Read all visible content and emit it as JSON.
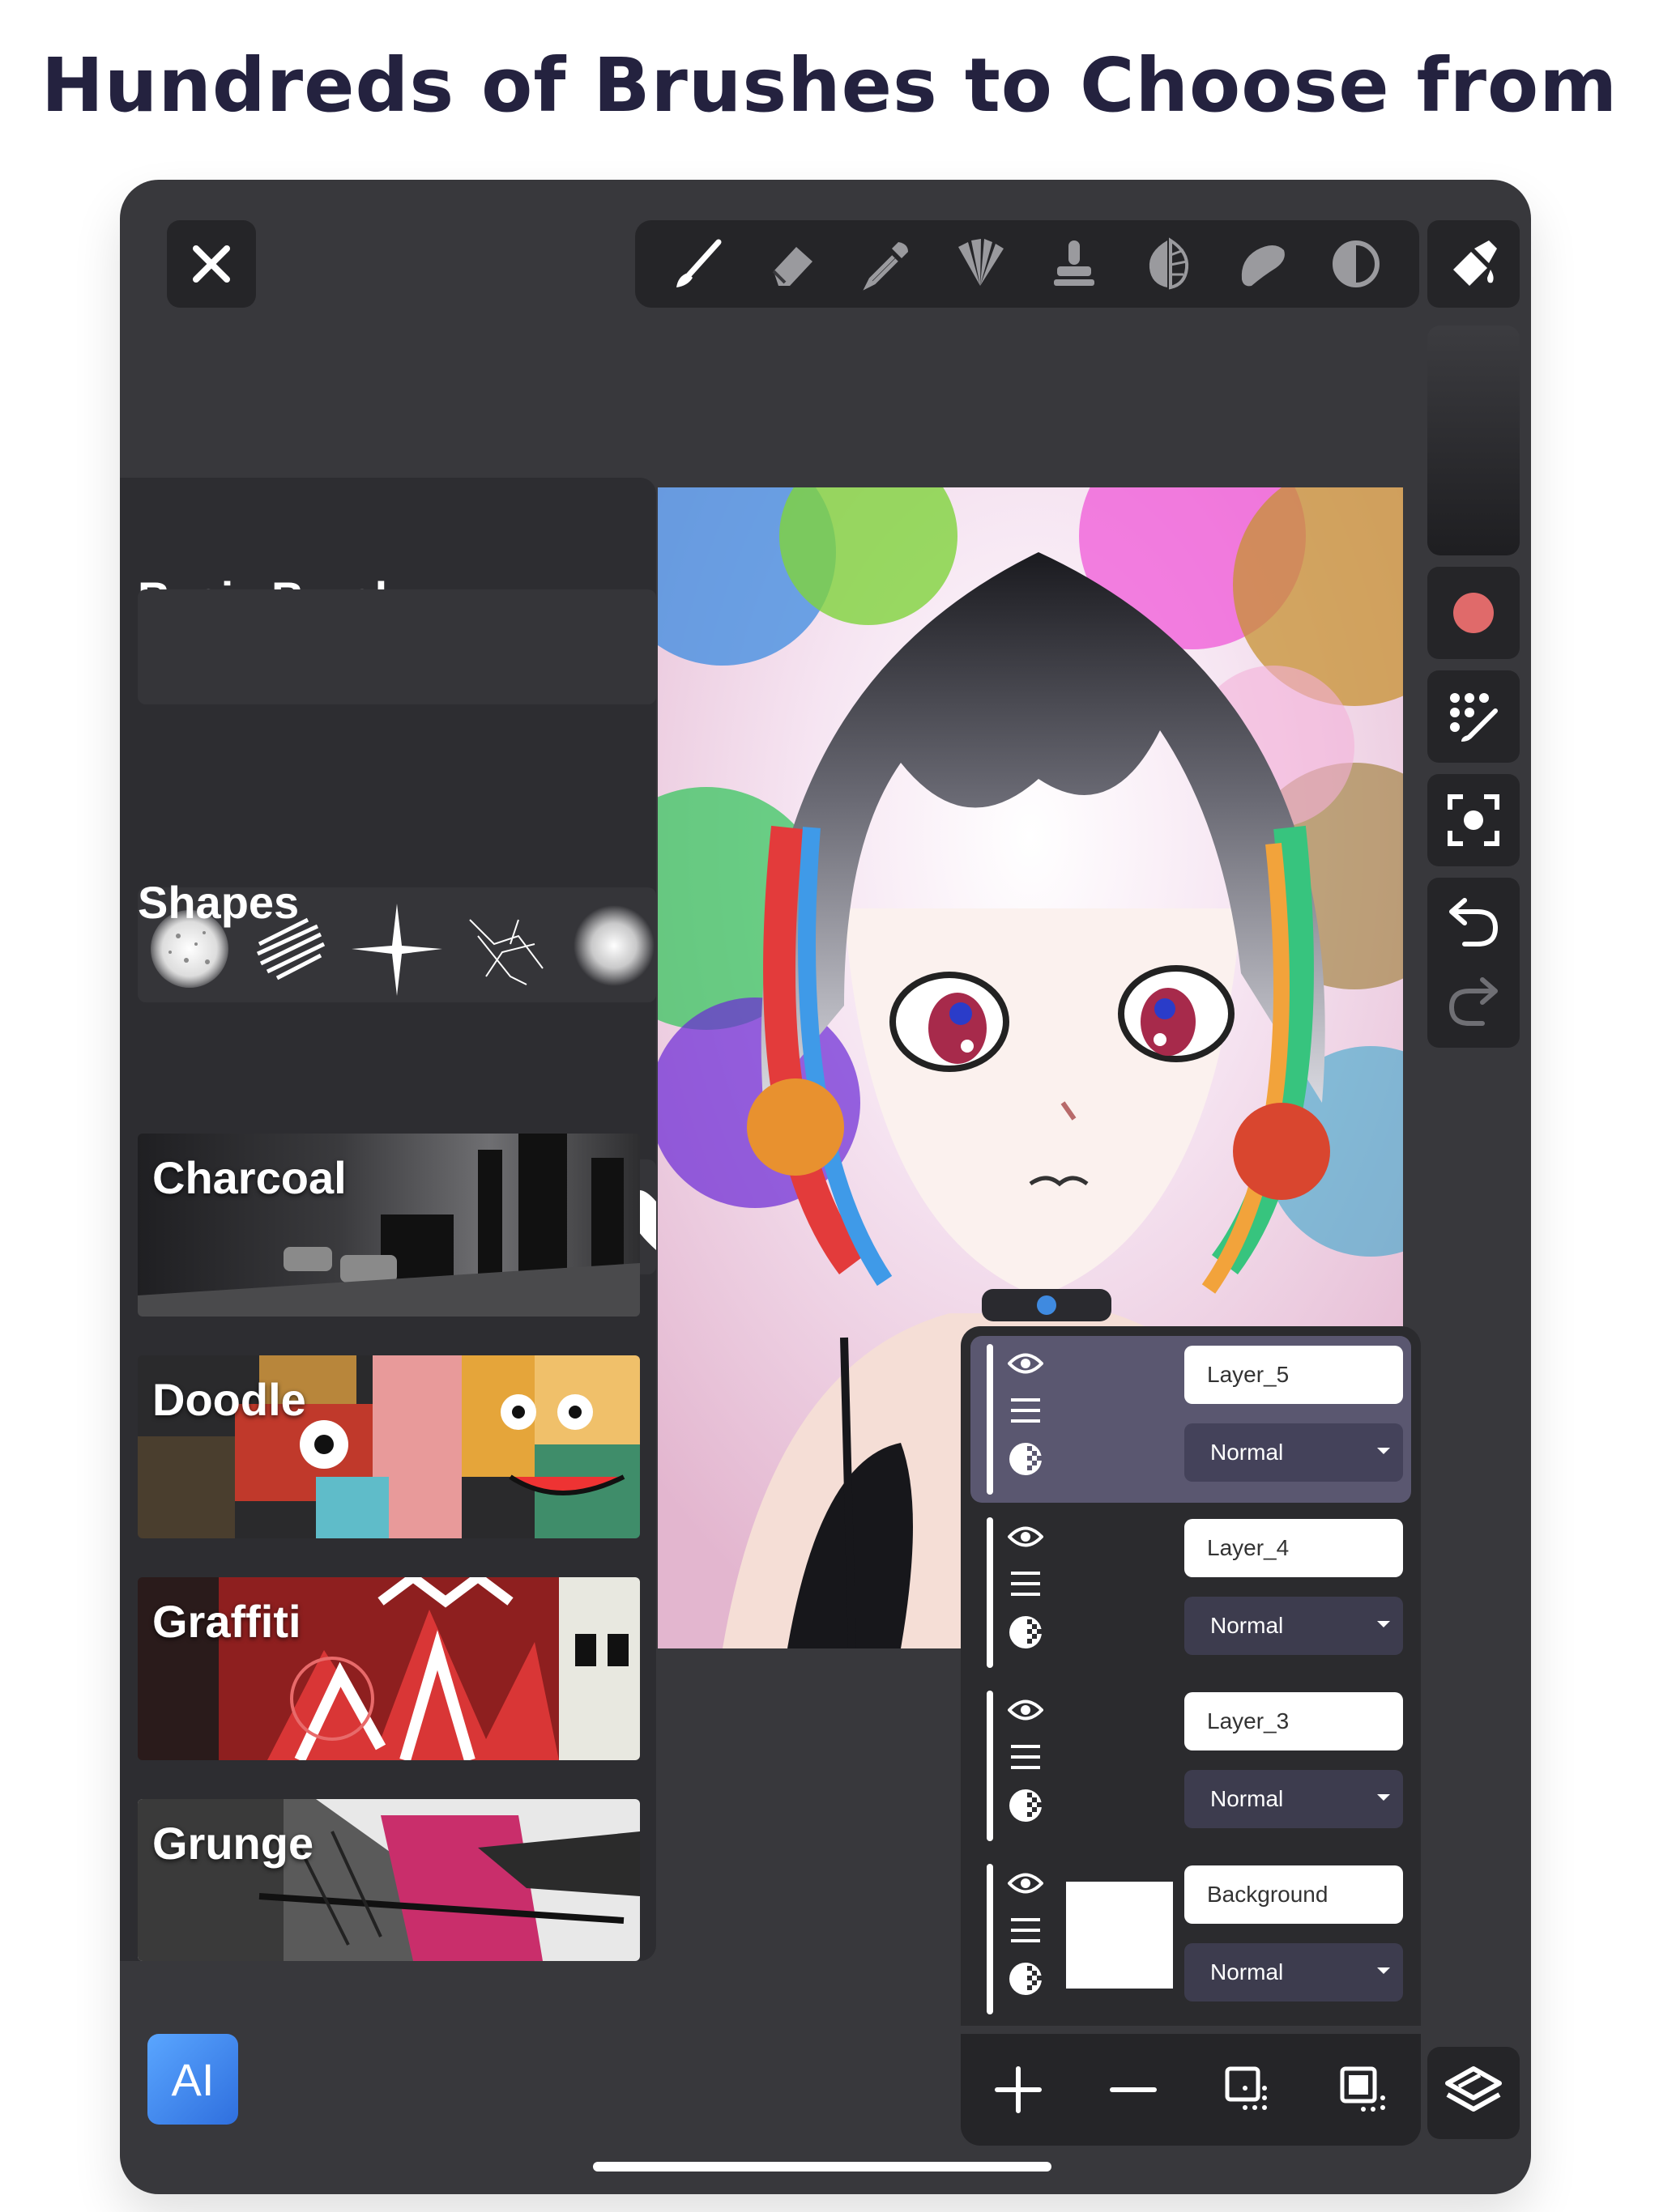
{
  "headline": "Hundreds of Brushes to Choose from",
  "brush_panel": {
    "sections": [
      {
        "title": "Basic Brush"
      },
      {
        "title": "Shapes"
      }
    ],
    "stroke_categories": [
      "Charcoal",
      "Doodle",
      "Graffiti",
      "Grunge"
    ]
  },
  "layers": [
    {
      "name": "Layer_5",
      "blend": "Normal",
      "selected": true
    },
    {
      "name": "Layer_4",
      "blend": "Normal",
      "selected": false
    },
    {
      "name": "Layer_3",
      "blend": "Normal",
      "selected": false
    },
    {
      "name": "Background",
      "blend": "Normal",
      "selected": false
    }
  ],
  "ai_button": "AI",
  "colors": {
    "current_color": "#e06a6a",
    "selected_layer_bg": "#5a5770",
    "headline": "#24223f"
  },
  "icons": {
    "toolbar": [
      "brush-icon",
      "eraser-icon",
      "eyedropper-icon",
      "fan-brush-icon",
      "stamp-icon",
      "leaf-brush-icon",
      "smudge-icon",
      "contrast-icon"
    ],
    "layer_actions": [
      "add-layer-icon",
      "remove-layer-icon",
      "duplicate-layer-icon",
      "merge-layer-icon"
    ]
  }
}
